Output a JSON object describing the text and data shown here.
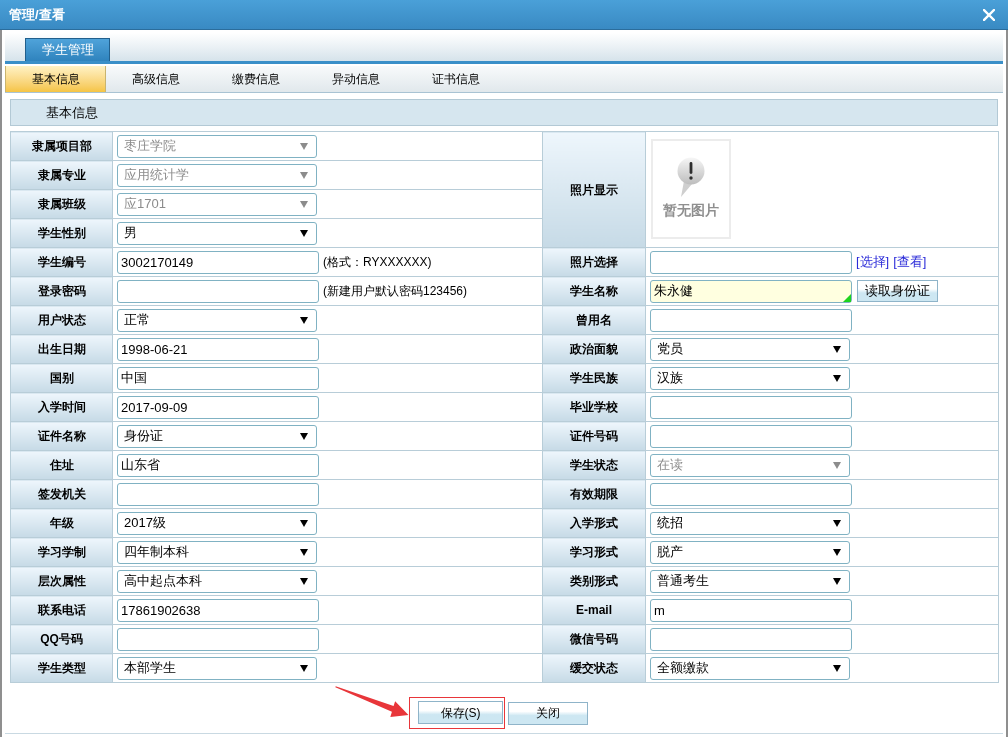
{
  "window": {
    "title": "管理/查看"
  },
  "module_tabs": [
    {
      "label": "学生管理",
      "selected": true
    }
  ],
  "tabs": [
    {
      "label": "基本信息",
      "selected": true
    },
    {
      "label": "高级信息",
      "selected": false
    },
    {
      "label": "缴费信息",
      "selected": false
    },
    {
      "label": "异动信息",
      "selected": false
    },
    {
      "label": "证书信息",
      "selected": false
    }
  ],
  "section": {
    "title": "基本信息"
  },
  "photo": {
    "label": "照片显示",
    "image_text": "暂无图片"
  },
  "left_fields": [
    {
      "label": "隶属项目部",
      "kind": "select",
      "value": "枣庄学院",
      "disabled": true
    },
    {
      "label": "隶属专业",
      "kind": "select",
      "value": "应用统计学",
      "disabled": true
    },
    {
      "label": "隶属班级",
      "kind": "select",
      "value": "应1701",
      "disabled": true
    },
    {
      "label": "学生性别",
      "kind": "select",
      "value": "男",
      "disabled": false
    },
    {
      "label": "学生编号",
      "kind": "input",
      "value": "3002170149",
      "disabled": false,
      "hint": "(格式：RYXXXXXX)"
    },
    {
      "label": "登录密码",
      "kind": "input",
      "disabled": false,
      "hint": "(新建用户默认密码123456)"
    },
    {
      "label": "用户状态",
      "kind": "select",
      "value": "正常",
      "disabled": false
    },
    {
      "label": "出生日期",
      "kind": "input",
      "value": "1998-06-21",
      "disabled": false
    },
    {
      "label": "国别",
      "kind": "input",
      "value": "中国",
      "disabled": false
    },
    {
      "label": "入学时间",
      "kind": "input",
      "value": "2017-09-09",
      "disabled": false
    },
    {
      "label": "证件名称",
      "kind": "select",
      "value": "身份证",
      "disabled": false
    },
    {
      "label": "住址",
      "kind": "input",
      "value": "山东省",
      "disabled": false
    },
    {
      "label": "签发机关",
      "kind": "input",
      "disabled": false
    },
    {
      "label": "年级",
      "kind": "select",
      "value": "2017级",
      "disabled": false
    },
    {
      "label": "学习学制",
      "kind": "select",
      "value": "四年制本科",
      "disabled": false
    },
    {
      "label": "层次属性",
      "kind": "select",
      "value": "高中起点本科",
      "disabled": false
    },
    {
      "label": "联系电话",
      "kind": "input",
      "value": "17861902638",
      "disabled": false
    },
    {
      "label": "QQ号码",
      "kind": "input",
      "disabled": false
    },
    {
      "label": "学生类型",
      "kind": "select",
      "value": "本部学生",
      "disabled": false
    }
  ],
  "right_fields": [
    {
      "label": "照片选择",
      "kind": "input",
      "disabled": false,
      "highlighted": false,
      "links": [
        "[选择]",
        "[查看]"
      ]
    },
    {
      "label": "学生名称",
      "kind": "input",
      "value": "朱永健",
      "disabled": false,
      "highlighted": true,
      "button": "读取身份证"
    },
    {
      "label": "曾用名",
      "kind": "input",
      "disabled": false,
      "highlighted": false
    },
    {
      "label": "政治面貌",
      "kind": "select",
      "value": "党员",
      "disabled": false,
      "highlighted": false
    },
    {
      "label": "学生民族",
      "kind": "select",
      "value": "汉族",
      "disabled": false,
      "highlighted": false
    },
    {
      "label": "毕业学校",
      "kind": "input",
      "disabled": false,
      "highlighted": false
    },
    {
      "label": "证件号码",
      "kind": "input",
      "disabled": false,
      "highlighted": false
    },
    {
      "label": "学生状态",
      "kind": "select",
      "value": "在读",
      "disabled": true,
      "highlighted": false
    },
    {
      "label": "有效期限",
      "kind": "input",
      "disabled": false,
      "highlighted": false
    },
    {
      "label": "入学形式",
      "kind": "select",
      "value": "统招",
      "disabled": false,
      "highlighted": false
    },
    {
      "label": "学习形式",
      "kind": "select",
      "value": "脱产",
      "disabled": false,
      "highlighted": false
    },
    {
      "label": "类别形式",
      "kind": "select",
      "value": "普通考生",
      "disabled": false,
      "highlighted": false
    },
    {
      "label": "E-mail",
      "kind": "input",
      "value": "m",
      "disabled": false,
      "highlighted": false
    },
    {
      "label": "微信号码",
      "kind": "input",
      "disabled": false,
      "highlighted": false
    },
    {
      "label": "缓交状态",
      "kind": "select",
      "value": "全额缴款",
      "disabled": false,
      "highlighted": false
    }
  ],
  "buttons": [
    {
      "label": "保存(S)",
      "highlighted": true
    },
    {
      "label": "关闭",
      "highlighted": false
    }
  ]
}
